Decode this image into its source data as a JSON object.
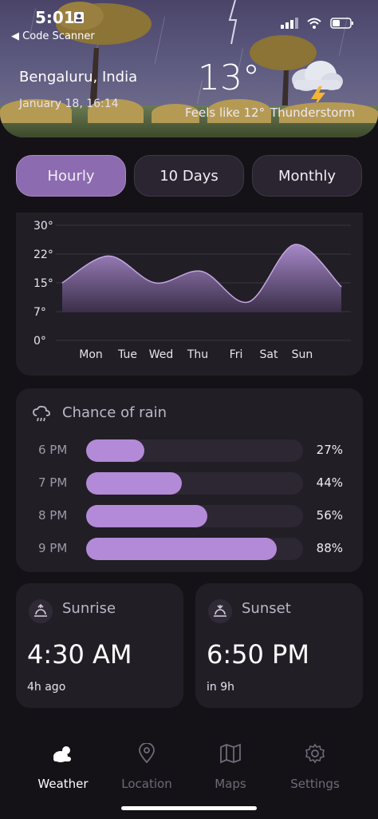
{
  "status_bar": {
    "time": "5:01",
    "back_label": "◀ Code Scanner"
  },
  "header": {
    "city": "Bengaluru, India",
    "date": "January 18, 16:14",
    "temperature": "13°",
    "feels_like": "Feels like 12°",
    "condition": "Thunderstorm",
    "icon": "thunderstorm-cloud-icon"
  },
  "tabs": [
    {
      "label": "Hourly",
      "active": true
    },
    {
      "label": "10 Days",
      "active": false
    },
    {
      "label": "Monthly",
      "active": false
    }
  ],
  "chart_data": {
    "type": "area",
    "categories": [
      "Mon",
      "Tue",
      "Wed",
      "Thu",
      "Fri",
      "Sat",
      "Sun"
    ],
    "series": [
      {
        "values": [
          15,
          22,
          15,
          18,
          10,
          25,
          14
        ]
      }
    ],
    "y_ticks": [
      "30°",
      "22°",
      "15°",
      "7°",
      "0°"
    ],
    "ylim": [
      0,
      30
    ],
    "grid": true,
    "color": "#8d6bb0"
  },
  "rain": {
    "title": "Chance of rain",
    "icon": "rain-cloud-icon",
    "rows": [
      {
        "time": "6 PM",
        "percent": "27%",
        "value": 27
      },
      {
        "time": "7 PM",
        "percent": "44%",
        "value": 44
      },
      {
        "time": "8 PM",
        "percent": "56%",
        "value": 56
      },
      {
        "time": "9 PM",
        "percent": "88%",
        "value": 88
      }
    ]
  },
  "sunrise": {
    "label": "Sunrise",
    "time": "4:30 AM",
    "relative": "4h ago",
    "icon": "sunrise-icon"
  },
  "sunset": {
    "label": "Sunset",
    "time": "6:50 PM",
    "relative": "in 9h",
    "icon": "sunset-icon"
  },
  "nav": [
    {
      "label": "Weather",
      "icon": "weather-icon",
      "active": true
    },
    {
      "label": "Location",
      "icon": "location-pin-icon",
      "active": false
    },
    {
      "label": "Maps",
      "icon": "map-icon",
      "active": false
    },
    {
      "label": "Settings",
      "icon": "gear-icon",
      "active": false
    }
  ],
  "colors": {
    "accent": "#8d6bb0",
    "bar_fill": "#b38ad8",
    "card": "#221e26",
    "background": "#151217"
  }
}
